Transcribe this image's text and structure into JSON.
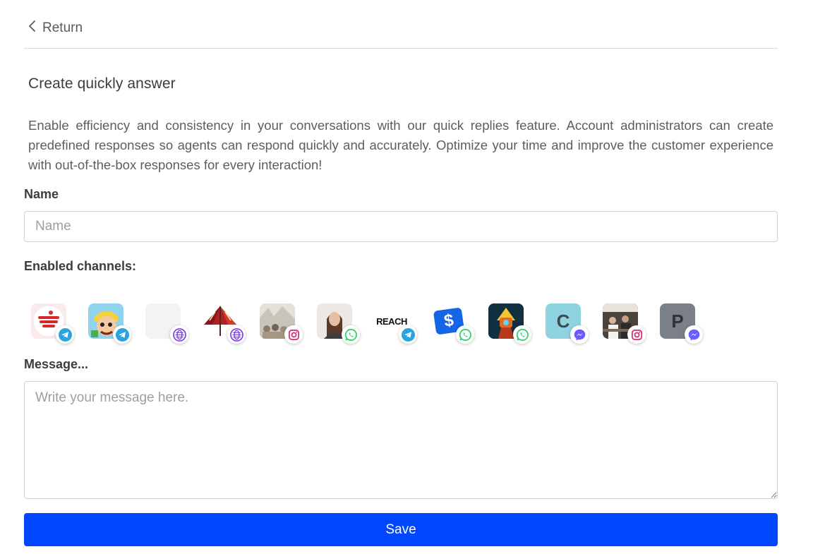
{
  "nav": {
    "return_label": "Return"
  },
  "header": {
    "title": "Create quickly answer",
    "description": "Enable efficiency and consistency in your conversations with our quick replies feature. Account administrators can create predefined responses so agents can respond quickly and accurately. Optimize your time and improve the customer experience with out-of-the-box responses for every interaction!"
  },
  "form": {
    "name_label": "Name",
    "name_placeholder": "Name",
    "name_value": "",
    "channels_label": "Enabled channels:",
    "message_label": "Message...",
    "message_placeholder": "Write your message here.",
    "message_value": "",
    "save_label": "Save"
  },
  "channels": [
    {
      "avatar_icon": "red-logo-avatar",
      "network": "telegram-icon"
    },
    {
      "avatar_icon": "cartoon-character-avatar",
      "network": "telegram-icon"
    },
    {
      "avatar_icon": "blank-avatar",
      "network": "webchat-icon"
    },
    {
      "avatar_icon": "umbrella-avatar",
      "network": "webchat-icon"
    },
    {
      "avatar_icon": "crowd-photo-avatar",
      "network": "instagram-icon"
    },
    {
      "avatar_icon": "woman-photo-avatar",
      "network": "whatsapp-icon"
    },
    {
      "avatar_icon": "reach-logo-avatar",
      "avatar_text": "REACH",
      "network": "telegram-icon"
    },
    {
      "avatar_icon": "dollar-logo-avatar",
      "avatar_text": "$",
      "network": "whatsapp-icon"
    },
    {
      "avatar_icon": "robot-avatar",
      "network": "whatsapp-icon"
    },
    {
      "avatar_icon": "letter-c-avatar",
      "avatar_text": "C",
      "network": "messenger-icon"
    },
    {
      "avatar_icon": "group-photo-avatar",
      "network": "instagram-icon"
    },
    {
      "avatar_icon": "letter-p-avatar",
      "avatar_text": "P",
      "network": "messenger-icon"
    }
  ],
  "colors": {
    "primary": "#0047ff",
    "telegram": "#2aa3df",
    "whatsapp": "#25d366",
    "webchat": "#7b3fe4",
    "instagram": "#d62976",
    "messenger": "#6a5cff"
  }
}
